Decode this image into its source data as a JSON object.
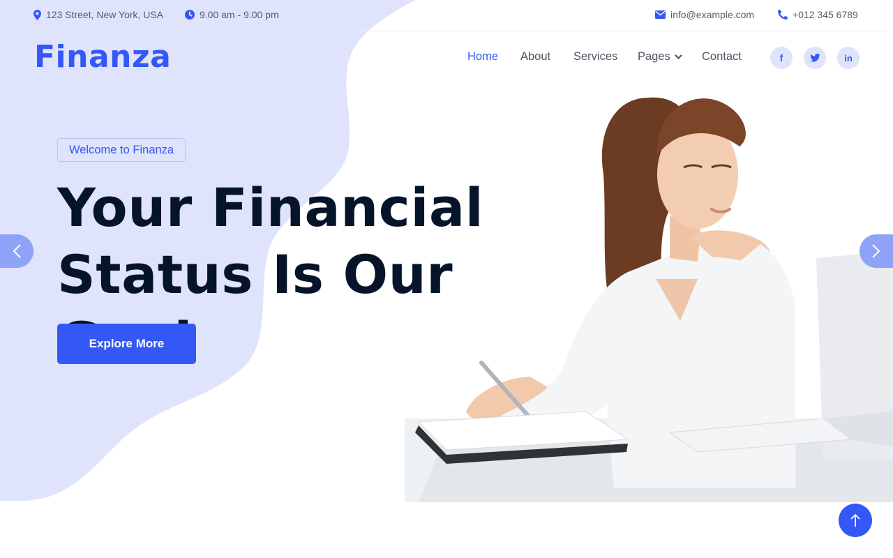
{
  "topbar": {
    "address": "123 Street, New York, USA",
    "hours": "9.00 am - 9.00 pm",
    "email": "info@example.com",
    "phone": "+012 345 6789"
  },
  "brand": {
    "logo": "Finanza"
  },
  "nav": {
    "items": [
      "Home",
      "About",
      "Services",
      "Pages",
      "Contact"
    ],
    "active": "Home"
  },
  "social": [
    {
      "icon": "facebook-icon",
      "glyph": "f"
    },
    {
      "icon": "twitter-icon",
      "glyph": ""
    },
    {
      "icon": "linkedin-icon",
      "glyph": "in"
    }
  ],
  "hero": {
    "badge": "Welcome to Finanza",
    "headline_line1": "Your Financial",
    "headline_line2": "Status Is Our Goal",
    "cta": "Explore More"
  },
  "colors": {
    "accent": "#3458f5",
    "blob": "#dfe3fb",
    "heading": "#061429",
    "arrow": "#8ea2f7"
  }
}
